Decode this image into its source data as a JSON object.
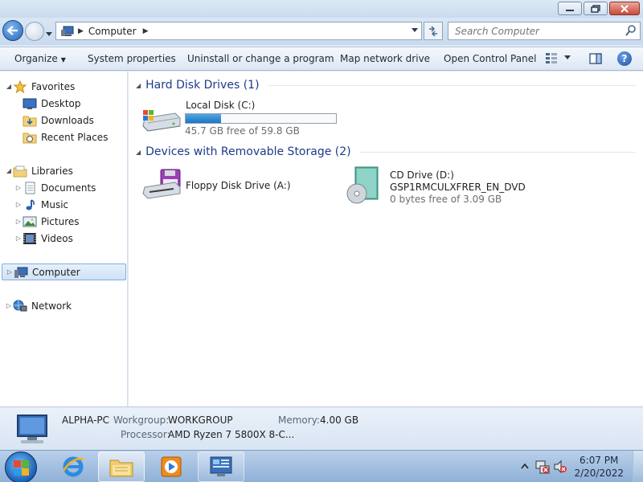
{
  "window": {
    "minimize_icon": "minimize-icon",
    "maximize_icon": "restore-icon",
    "close_icon": "close-icon"
  },
  "navigation": {
    "address_path": [
      "Computer"
    ],
    "search_placeholder": "Search Computer"
  },
  "command_bar": {
    "organize": "Organize",
    "system_properties": "System properties",
    "uninstall": "Uninstall or change a program",
    "map_network_drive": "Map network drive",
    "open_control_panel": "Open Control Panel"
  },
  "nav_pane": {
    "favorites": "Favorites",
    "desktop": "Desktop",
    "downloads": "Downloads",
    "recent_places": "Recent Places",
    "libraries": "Libraries",
    "documents": "Documents",
    "music": "Music",
    "pictures": "Pictures",
    "videos": "Videos",
    "computer": "Computer",
    "network": "Network"
  },
  "content": {
    "hard_disk_group": "Hard Disk Drives (1)",
    "removable_group": "Devices with Removable Storage (2)",
    "local_disk": {
      "name": "Local Disk (C:)",
      "free": "45.7 GB free of 59.8 GB",
      "used_fraction": 0.236
    },
    "floppy": {
      "name": "Floppy Disk Drive (A:)"
    },
    "cd_drive": {
      "name": "CD Drive (D:)",
      "label": "GSP1RMCULXFRER_EN_DVD",
      "free": "0 bytes free of 3.09 GB"
    }
  },
  "details": {
    "computer_name": "ALPHA-PC",
    "workgroup_label": "Workgroup:",
    "workgroup": "WORKGROUP",
    "memory_label": "Memory:",
    "memory": "4.00 GB",
    "processor_label": "Processor:",
    "processor": "AMD Ryzen 7 5800X 8-C..."
  },
  "taskbar": {
    "time": "6:07 PM",
    "date": "2/20/2022"
  },
  "colors": {
    "accent": "#1e3a8a",
    "usage_bar": "#2a86d3"
  }
}
